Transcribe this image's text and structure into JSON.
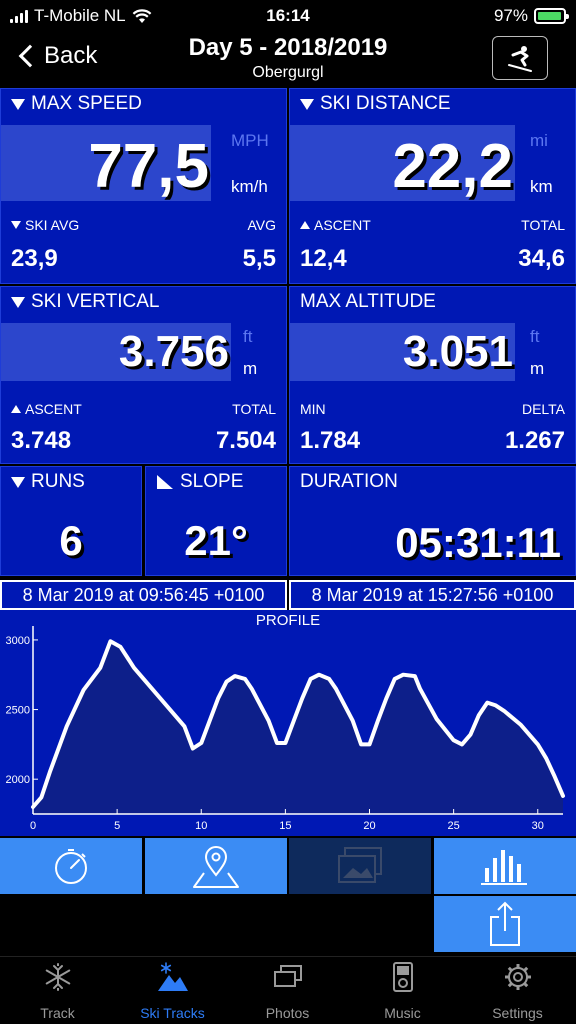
{
  "status": {
    "carrier": "T-Mobile NL",
    "time": "16:14",
    "battery": "97%",
    "battery_level": 0.97
  },
  "nav": {
    "back_label": "Back",
    "title": "Day 5 - 2018/2019",
    "subtitle": "Obergurgl",
    "action_icon": "skier-icon"
  },
  "max_speed": {
    "title": "MAX SPEED",
    "value": "77,5",
    "unit_alt": "MPH",
    "unit": "km/h",
    "left_label": "SKI AVG",
    "left_value": "23,9",
    "right_label": "AVG",
    "right_value": "5,5"
  },
  "ski_distance": {
    "title": "SKI DISTANCE",
    "value": "22,2",
    "unit_alt": "mi",
    "unit": "km",
    "left_label": "ASCENT",
    "left_value": "12,4",
    "right_label": "TOTAL",
    "right_value": "34,6"
  },
  "ski_vertical": {
    "title": "SKI VERTICAL",
    "value": "3.756",
    "unit_alt": "ft",
    "unit": "m",
    "left_label": "ASCENT",
    "left_value": "3.748",
    "right_label": "TOTAL",
    "right_value": "7.504"
  },
  "max_altitude": {
    "title": "MAX ALTITUDE",
    "value": "3.051",
    "unit_alt": "ft",
    "unit": "m",
    "left_label": "MIN",
    "left_value": "1.784",
    "right_label": "DELTA",
    "right_value": "1.267"
  },
  "runs": {
    "title": "RUNS",
    "value": "6"
  },
  "slope": {
    "title": "SLOPE",
    "value": "21°"
  },
  "duration": {
    "title": "DURATION",
    "value": "05:31:11"
  },
  "dates": {
    "start": "8 Mar 2019 at 09:56:45 +0100",
    "end": "8 Mar 2019 at 15:27:56 +0100"
  },
  "chart_data": {
    "type": "area",
    "title": "PROFILE",
    "xlim": [
      0,
      31.5
    ],
    "ylim": [
      1750,
      3100
    ],
    "x_ticks": [
      0,
      5,
      10,
      15,
      20,
      25,
      30
    ],
    "y_ticks": [
      2000,
      2500,
      3000
    ],
    "grid": false,
    "series": [
      {
        "x": [
          0,
          0.5,
          1,
          2,
          3,
          4,
          4.6,
          5.2,
          6,
          7,
          8,
          9,
          9.5,
          10,
          10.5,
          11,
          11.5,
          12,
          12.6,
          13,
          14,
          14.5,
          15,
          15.5,
          16,
          16.5,
          17,
          17.6,
          18,
          19,
          19.5,
          20,
          20.5,
          21,
          21.5,
          22,
          22.7,
          23,
          24,
          25,
          25.5,
          26,
          26.5,
          27,
          27.5,
          28,
          29,
          30,
          30.5,
          31,
          31.5
        ],
        "y": [
          1800,
          1870,
          2050,
          2380,
          2640,
          2800,
          2990,
          2950,
          2800,
          2660,
          2520,
          2380,
          2220,
          2260,
          2420,
          2580,
          2700,
          2740,
          2720,
          2650,
          2420,
          2260,
          2260,
          2420,
          2580,
          2720,
          2750,
          2720,
          2650,
          2420,
          2250,
          2250,
          2420,
          2580,
          2720,
          2750,
          2740,
          2650,
          2430,
          2280,
          2250,
          2320,
          2460,
          2550,
          2530,
          2490,
          2390,
          2250,
          2150,
          2020,
          1880
        ]
      }
    ]
  },
  "actions": {
    "stopwatch_icon": "stopwatch-icon",
    "map_icon": "map-pin-icon",
    "photos_icon": "photos-icon",
    "chart_icon": "bar-chart-icon",
    "share_icon": "share-icon"
  },
  "tabs": [
    {
      "label": "Track",
      "icon": "snowflake-icon"
    },
    {
      "label": "Ski Tracks",
      "icon": "mountain-snowflake-icon"
    },
    {
      "label": "Photos",
      "icon": "photos-icon"
    },
    {
      "label": "Music",
      "icon": "ipod-icon"
    },
    {
      "label": "Settings",
      "icon": "gear-icon"
    }
  ],
  "colors": {
    "panel": "#0018b4",
    "value_box": "#2c46cc",
    "button": "#3b8cf4",
    "active_tab": "#2e7cf6"
  }
}
